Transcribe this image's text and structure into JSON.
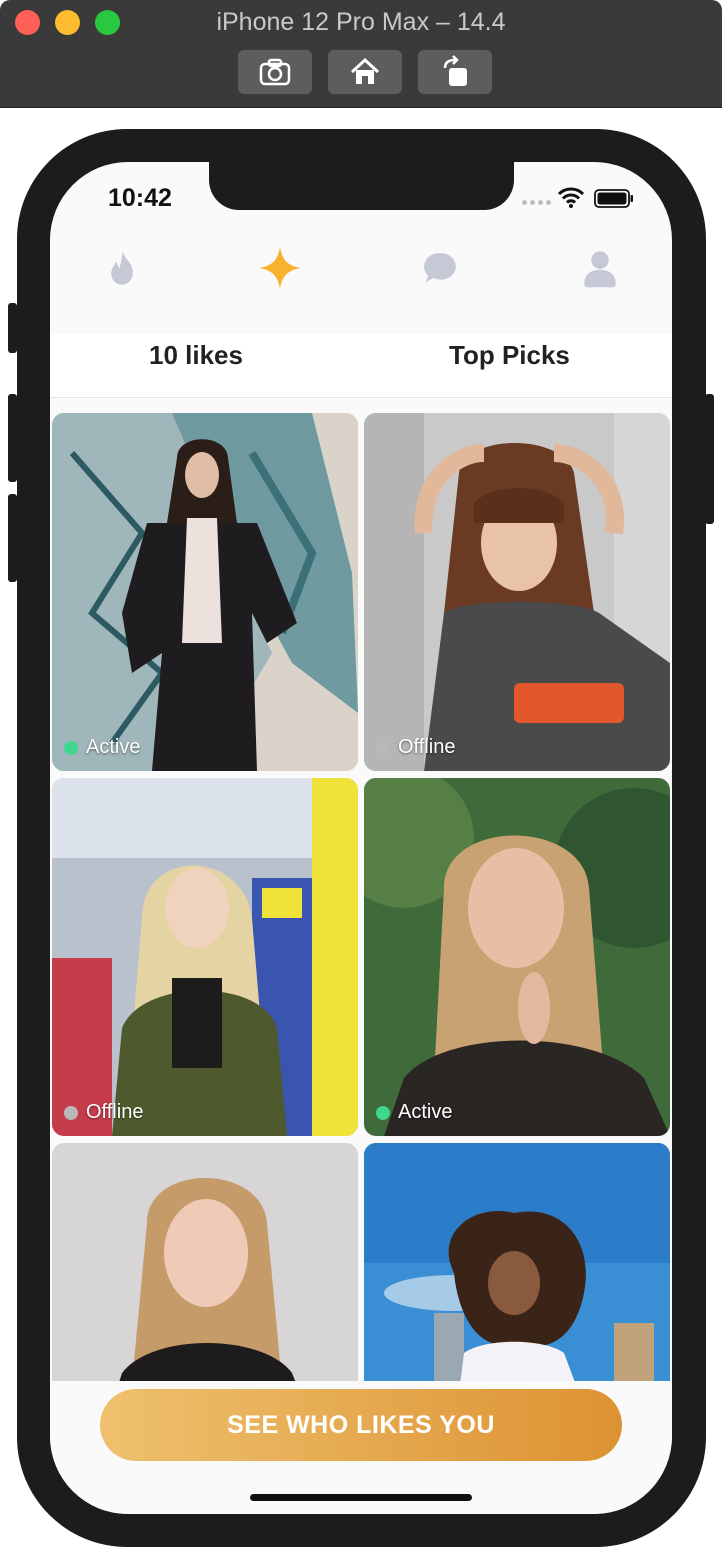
{
  "window": {
    "title": "iPhone 12 Pro Max – 14.4",
    "buttons": [
      {
        "icon": "screenshot-icon"
      },
      {
        "icon": "home-icon"
      },
      {
        "icon": "rotate-icon"
      }
    ]
  },
  "status_bar": {
    "time": "10:42"
  },
  "nav": {
    "icons": [
      "flame-icon",
      "sparkle-icon",
      "chat-icon",
      "profile-icon"
    ],
    "active_color": "#f7b32d",
    "inactive_color": "#c5c9d6"
  },
  "tabs": [
    {
      "label": "10 likes"
    },
    {
      "label": "Top Picks"
    }
  ],
  "cards": [
    {
      "status": "Active",
      "dot_color": "#3fd68d"
    },
    {
      "status": "Offline",
      "dot_color": "#b8b8b8"
    },
    {
      "status": "Offline",
      "dot_color": "#b8b8b8"
    },
    {
      "status": "Active",
      "dot_color": "#3fd68d"
    },
    {
      "status": "",
      "dot_color": ""
    },
    {
      "status": "",
      "dot_color": ""
    }
  ],
  "cta": {
    "label": "SEE WHO LIKES YOU",
    "gradient_start": "#eec16e",
    "gradient_end": "#dd9232"
  }
}
